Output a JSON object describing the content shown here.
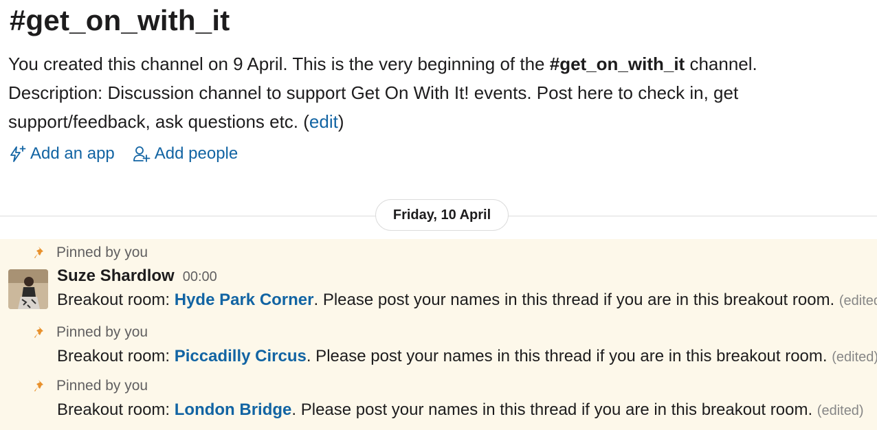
{
  "channel": {
    "name": "#get_on_with_it"
  },
  "intro": {
    "prefix": "You created this channel on 9 April. This is the very beginning of the ",
    "channel_name": "#get_on_with_it",
    "suffix": " channel.",
    "description": "Description: Discussion channel to support Get On With It! events. Post here to check in, get support/feedback, ask questions etc. (",
    "edit_label": "edit",
    "close_paren": ")"
  },
  "actions": {
    "add_app_label": "Add an app",
    "add_people_label": "Add people"
  },
  "date_divider": {
    "label": "Friday, 10 April"
  },
  "pinned_label": "Pinned by you",
  "sender": {
    "name": "Suze Shardlow",
    "time": "00:00"
  },
  "messages": [
    {
      "prefix": "Breakout room: ",
      "room": "Hyde Park Corner",
      "body": ".  Please post your names in this thread if you are in this breakout room. ",
      "edited": "(edited)"
    },
    {
      "prefix": "Breakout room: ",
      "room": "Piccadilly Circus",
      "body": ".  Please post your names in this thread if you are in this breakout room. ",
      "edited": "(edited)"
    },
    {
      "prefix": "Breakout room: ",
      "room": "London Bridge",
      "body": ".  Please post your names in this thread if you are in this breakout room. ",
      "edited": "(edited)"
    }
  ],
  "colors": {
    "link": "#1264a3",
    "pin": "#e8912d",
    "pinned_bg": "#fdf8ea"
  }
}
